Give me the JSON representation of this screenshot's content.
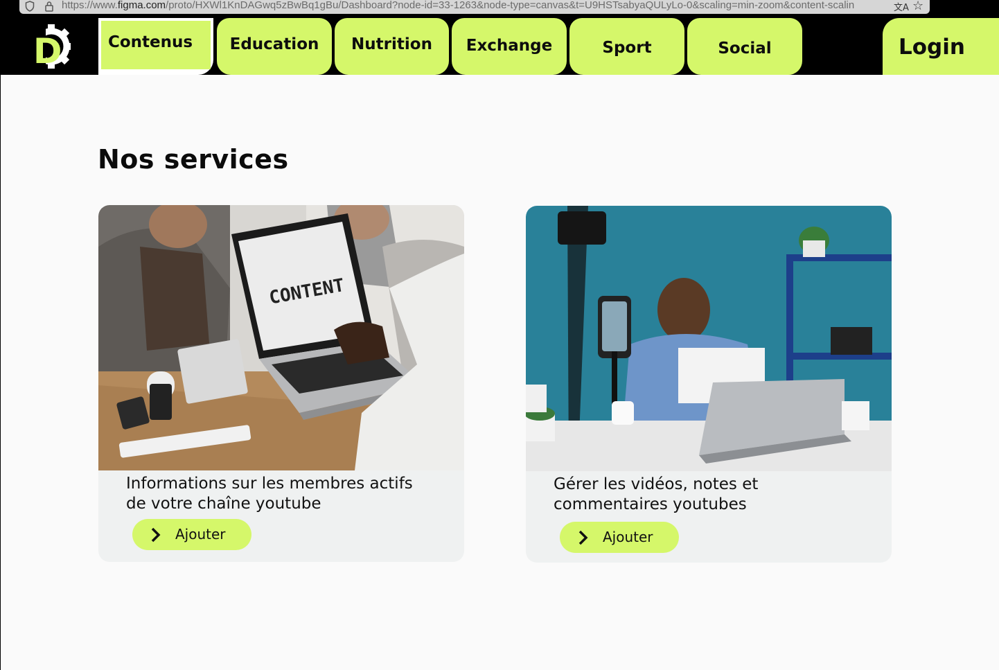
{
  "browser": {
    "url_prefix": "https://www.",
    "url_domain": "figma.com",
    "url_rest": "/proto/HXWl1KnDAGwq5zBwBq1gBu/Dashboard?node-id=33-1263&node-type=canvas&t=U9HSTsabyaQULyLo-0&scaling=min-zoom&content-scalin"
  },
  "nav": {
    "logo_letter": "D",
    "tabs": [
      {
        "label": "Contenus",
        "active": true
      },
      {
        "label": "Education"
      },
      {
        "label": "Nutrition"
      },
      {
        "label": "Exchange"
      },
      {
        "label": "Sport"
      },
      {
        "label": "Social"
      }
    ],
    "login_label": "Login"
  },
  "main": {
    "title": "Nos services",
    "cards": [
      {
        "image_text": "CONTENT",
        "text_line1": "Informations sur les membres actifs",
        "text_line2": "de votre chaîne youtube",
        "button_label": "Ajouter"
      },
      {
        "text_line1": "Gérer les vidéos, notes et",
        "text_line2": "commentaires youtubes",
        "button_label": "Ajouter"
      }
    ]
  },
  "colors": {
    "accent": "#d5f76a",
    "nav_bg": "#000000",
    "page_bg": "#fafafa",
    "card_bg": "#eff1f1",
    "studio_wall": "#2f8aa3"
  }
}
